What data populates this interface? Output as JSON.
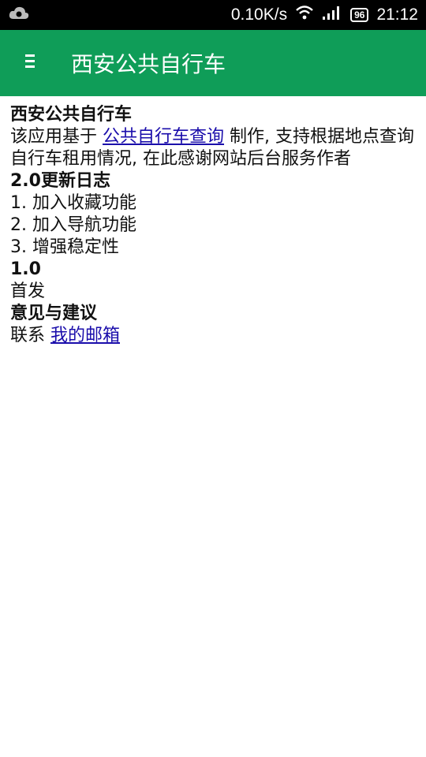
{
  "status_bar": {
    "net_speed": "0.10K/s",
    "battery": "96",
    "time": "21:12",
    "icons": [
      "notification-cloud-icon",
      "wifi-icon",
      "signal-icon",
      "battery-icon"
    ]
  },
  "app_bar": {
    "title": "西安公共自行车",
    "menu_icon": "menu-icon",
    "color": "#0f9d58"
  },
  "content": {
    "heading_app": "西安公共自行车",
    "intro_prefix": "该应用基于 ",
    "intro_link": "公共自行车查询",
    "intro_suffix": " 制作, 支持根据地点查询自行车租用情况, 在此感谢网站后台服务作者",
    "changelog_heading": "2.0更新日志",
    "changelog_items": [
      "1. 加入收藏功能",
      "2. 加入导航功能",
      "3. 增强稳定性"
    ],
    "v1_heading": "1.0",
    "v1_text": "首发",
    "feedback_heading": "意见与建议",
    "contact_prefix": "联系 ",
    "contact_link": "我的邮箱"
  }
}
